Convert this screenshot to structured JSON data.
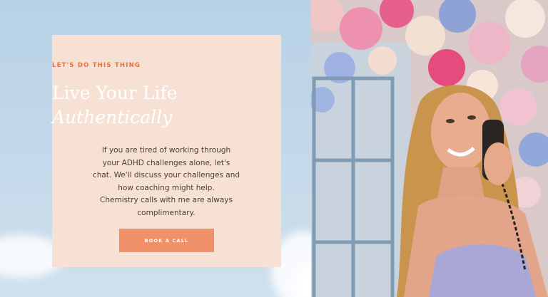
{
  "section": {
    "eyebrow": "LET'S DO THIS THING",
    "title_line1": "Live Your Life",
    "title_line2": "Authentically",
    "body_lines": [
      "If you are tired of working through",
      "your ADHD challenges alone, let's",
      "chat. We'll discuss your challenges and",
      "how coaching might help.",
      "Chemistry calls with me are always",
      "complimentary."
    ],
    "cta_label": "BOOK A CALL"
  },
  "colors": {
    "card_bg": "#f6e1d4",
    "accent": "#e46f43",
    "button": "#f0916a",
    "sky": "#c4d9ea"
  },
  "photo": {
    "icon": "portrait-photo-icon"
  }
}
